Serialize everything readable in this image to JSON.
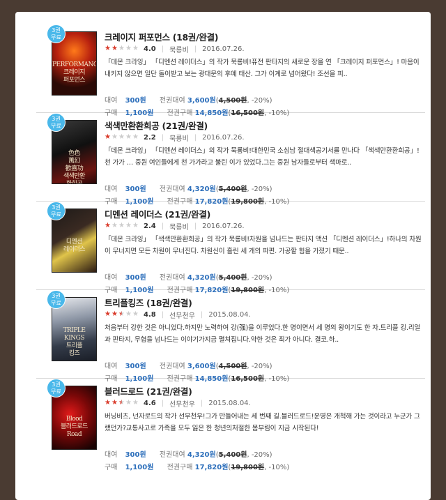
{
  "colors": {
    "badge": "#4ab8ea",
    "price": "#2d6fbb",
    "star_on": "#d93a2a",
    "star_off": "#cccccc"
  },
  "labels": {
    "rent": "대여",
    "buy": "구매",
    "all_rent": "전권대여",
    "all_buy": "전권구매"
  },
  "books": [
    {
      "badge_line1": "3권",
      "badge_line2": "무료",
      "cover_title": "PERFORMANCE\n크레이지\n퍼포먼스",
      "title": "크레이지 퍼포먼스 (18권/완결)",
      "rating": 4.0,
      "rating_text": "4.0",
      "author": "묵룡비",
      "date": "2016.07.26.",
      "description": "「데몬 크라잉」 「디멘션 레이더스」의 작가 묵룡비!퓨전 판타지의 새로운 장을 연 「크레이지 퍼포먼스」! 마음이 내키지 않으면 일단 돌이받고 보는 광대문의 후예 태산. 그가 이계로 넘어왔다! 조선을 피..",
      "rent_price": "300원",
      "all_rent_price": "3,600원",
      "all_rent_orig": "4,500원",
      "all_rent_disc": "-20%",
      "buy_price": "1,100원",
      "all_buy_price": "14,850원",
      "all_buy_orig": "16,500원",
      "all_buy_disc": "-10%"
    },
    {
      "badge_line1": "3권",
      "badge_line2": "무료",
      "cover_title": "色色\n萬幻\n歡喜功\n색색만환\n환희공",
      "title": "색색만환환희공 (21권/완결)",
      "rating": 2.2,
      "rating_text": "2.2",
      "author": "묵룡비",
      "date": "2016.07.26.",
      "description": "「데몬 크라잉」 「디멘션 레이더스」의 작가 묵룡비!대한민국 소심남 절대색공기서를 만나다 「색색만환환희공」!천 가가 … 중원 여인들에게 천 가가라고 불린 이가 있었다.그는 중원 남자들로부터 색마로..",
      "rent_price": "300원",
      "all_rent_price": "4,320원",
      "all_rent_orig": "5,400원",
      "all_rent_disc": "-20%",
      "buy_price": "1,100원",
      "all_buy_price": "17,820원",
      "all_buy_orig": "19,800원",
      "all_buy_disc": "-10%"
    },
    {
      "badge_line1": "3권",
      "badge_line2": "무료",
      "cover_title": "디멘션\n레이더스",
      "title": "디멘션 레이더스 (21권/완결)",
      "rating": 2.4,
      "rating_text": "2.4",
      "author": "묵룡비",
      "date": "2016.07.26.",
      "description": "「데몬 크라잉」 「색색만환환희공」의 작가 묵룡비!차원을 넘나드는 판타지 액션 「디멘션 레이더스」!하나의 차원이 무너지면 모든 차원이 무너진다. 차원신이 흘린 세 개의 파편. 가공할 힘을 가졌기 때문..",
      "rent_price": "300원",
      "all_rent_price": "4,320원",
      "all_rent_orig": "5,400원",
      "all_rent_disc": "-20%",
      "buy_price": "1,100원",
      "all_buy_price": "17,820원",
      "all_buy_orig": "19,800원",
      "all_buy_disc": "-10%"
    },
    {
      "badge_line1": "3권",
      "badge_line2": "무료",
      "cover_title": "TRIPLE\nKINGS\n트리플\n킹즈",
      "title": "트리플킹즈 (18권/완결)",
      "rating": 4.8,
      "rating_text": "4.8",
      "author": "선무천우",
      "date": "2015.08.04.",
      "description": "처음부터 강한 것은 아니었다.하지만 노력하여 강(强)을 이루었다.한 명이면서 세 명의 왕이기도 한 자.트리플 킹.리얼과 판타지, 무협을 넘나드는 이야기가지금 펼쳐집니다.약한 것은 죄가 아니다. 결코.하..",
      "rent_price": "300원",
      "all_rent_price": "3,600원",
      "all_rent_orig": "4,500원",
      "all_rent_disc": "-20%",
      "buy_price": "1,100원",
      "all_buy_price": "14,850원",
      "all_buy_orig": "16,500원",
      "all_buy_disc": "-10%"
    },
    {
      "badge_line1": "3권",
      "badge_line2": "무료",
      "cover_title": "Blood\n블러드로드\nRoad",
      "title": "블러드로드 (21권/완결)",
      "rating": 4.6,
      "rating_text": "4.6",
      "author": "선무천우",
      "date": "2015.08.04.",
      "description": "버닝비츠, 넌자로드의 작가 선무천우!그가 만들어내는 세 번째 길.블러드로드!운명은 개척해 가는 것이라고 누군가 그랬던가?교통사고로 가족을 모두 잃은 한 청년의처절한 몸부림이 지금 시작된다!",
      "rent_price": "300원",
      "all_rent_price": "4,320원",
      "all_rent_orig": "5,400원",
      "all_rent_disc": "-20%",
      "buy_price": "1,100원",
      "all_buy_price": "17,820원",
      "all_buy_orig": "19,800원",
      "all_buy_disc": "-10%"
    }
  ]
}
